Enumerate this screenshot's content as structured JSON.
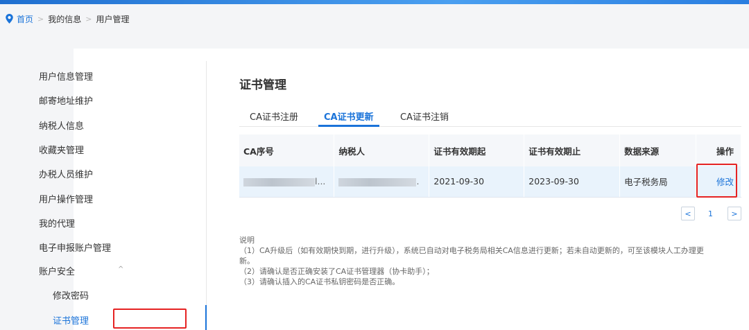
{
  "breadcrumb": {
    "home": "首页",
    "sep": ">",
    "level2": "我的信息",
    "level3": "用户管理"
  },
  "menu": {
    "items": [
      {
        "label": "用户信息管理"
      },
      {
        "label": "邮寄地址维护"
      },
      {
        "label": "纳税人信息"
      },
      {
        "label": "收藏夹管理"
      },
      {
        "label": "办税人员维护"
      },
      {
        "label": "用户操作管理"
      },
      {
        "label": "我的代理"
      },
      {
        "label": "电子申报账户管理"
      },
      {
        "label": "账户安全",
        "caret": "^"
      },
      {
        "label": "修改密码"
      },
      {
        "label": "证书管理"
      }
    ]
  },
  "page": {
    "title": "证书管理"
  },
  "tabs": [
    {
      "label": "CA证书注册"
    },
    {
      "label": "CA证书更新"
    },
    {
      "label": "CA证书注销"
    }
  ],
  "table": {
    "headers": [
      "CA序号",
      "纳税人",
      "证书有效期起",
      "证书有效期止",
      "数据来源",
      "操作"
    ],
    "rows": [
      {
        "ca_suffix": "l...",
        "taxpayer_suffix": ".",
        "start": "2021-09-30",
        "end": "2023-09-30",
        "source": "电子税务局",
        "action": "修改"
      }
    ]
  },
  "pager": {
    "prev": "<",
    "page": "1",
    "next": ">"
  },
  "notes": {
    "heading": "说明",
    "lines": [
      "（1）CA升级后（如有效期快到期，进行升级），系统已自动对电子税务局相关CA信息进行更新；若未自动更新的，可至该模块人工办理更",
      "新。",
      "（2）请确认是否正确安装了CA证书管理器（协卡助手）；",
      "（3）请确认插入的CA证书私钥密码是否正确。"
    ]
  },
  "colors": {
    "accent": "#1a73d9",
    "highlight": "#e52222"
  },
  "icons": {
    "location": "location-pin-icon",
    "collapse": "chevron-up-icon"
  }
}
